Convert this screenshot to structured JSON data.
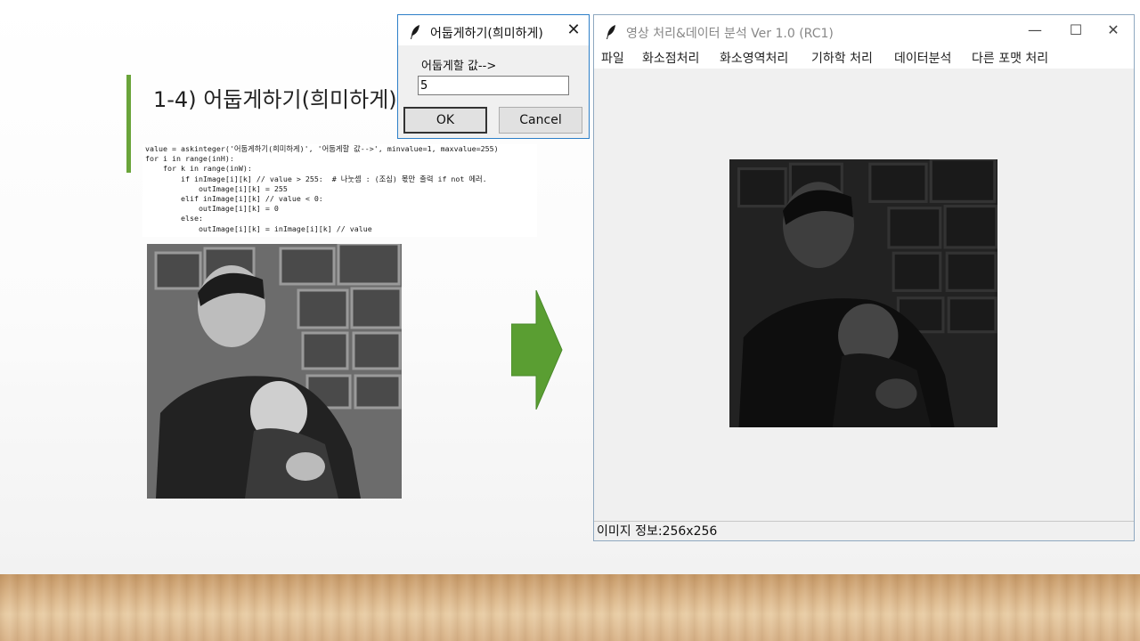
{
  "slide": {
    "title": "1-4) 어둡게하기(희미하게)",
    "code_lines": [
      "value = askinteger('어둡게하기(희미하게)', '어둡게할 값-->', minvalue=1, maxvalue=255)",
      "for i in range(inH):",
      "    for k in range(inW):",
      "        if inImage[i][k] // value > 255:  # 나눗셈 : (조심) 몫만 출력 if not 에러.",
      "            outImage[i][k] = 255",
      "        elif inImage[i][k] // value < 0:",
      "            outImage[i][k] = 0",
      "        else:",
      "            outImage[i][k] = inImage[i][k] // value"
    ],
    "arrow_color": "#5a9e32",
    "accent_color": "#6aa43a"
  },
  "main_window": {
    "title": "영상 처리&데이터 분석 Ver 1.0 (RC1)",
    "menu": [
      "파일",
      "화소점처리",
      "화소영역처리",
      "기하학 처리",
      "데이터분석",
      "다른 포맷 처리"
    ],
    "status": "이미지 정보:256x256",
    "controls": {
      "minimize": "—",
      "maximize": "☐",
      "close": "✕"
    }
  },
  "dialog": {
    "title": "어둡게하기(희미하게)",
    "label": "어둡게할 값-->",
    "input_value": "5",
    "ok": "OK",
    "cancel": "Cancel",
    "close": "✕"
  }
}
